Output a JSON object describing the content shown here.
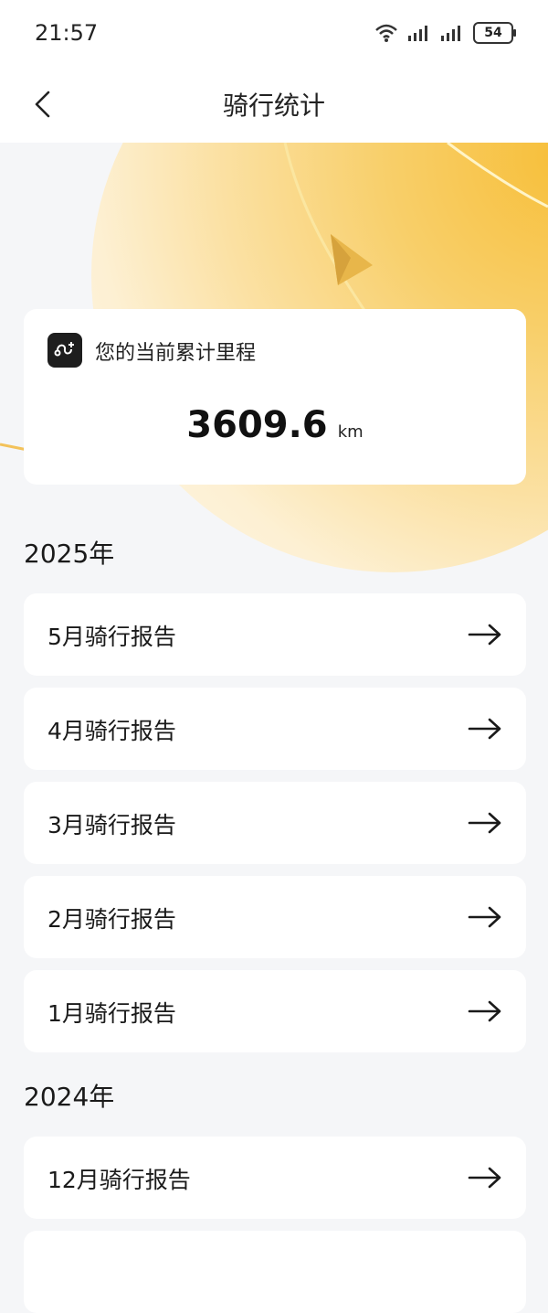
{
  "status_bar": {
    "time": "21:57",
    "battery": "54",
    "icons": [
      "wifi-icon",
      "signal-icon",
      "signal-icon",
      "battery-icon"
    ]
  },
  "nav": {
    "title": "骑行统计",
    "back_icon": "chevron-left-icon"
  },
  "mileage": {
    "label": "您的当前累计里程",
    "value": "3609.6",
    "unit": "km",
    "icon": "route-icon"
  },
  "sections": [
    {
      "year": "2025年",
      "reports": [
        {
          "label": "5月骑行报告"
        },
        {
          "label": "4月骑行报告"
        },
        {
          "label": "3月骑行报告"
        },
        {
          "label": "2月骑行报告"
        },
        {
          "label": "1月骑行报告"
        }
      ]
    },
    {
      "year": "2024年",
      "reports": [
        {
          "label": "12月骑行报告"
        }
      ]
    }
  ],
  "colors": {
    "accent": "#f7bf3a",
    "background": "#f5f6f8",
    "card": "#ffffff",
    "text": "#1a1a1a"
  }
}
